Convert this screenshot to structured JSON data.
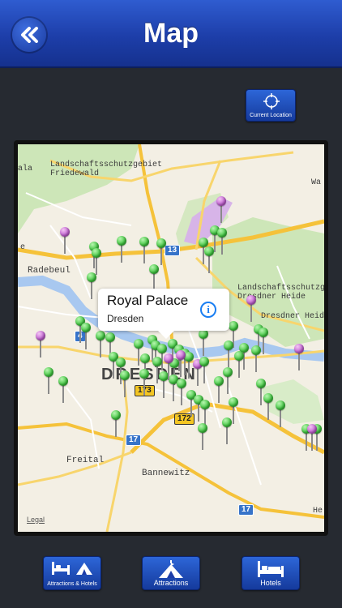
{
  "header": {
    "title": "Map",
    "back_icon": "double-chevron-left-icon"
  },
  "toolbar": {
    "current_location_label": "Current Location",
    "current_location_icon": "crosshair-icon"
  },
  "map": {
    "labels": {
      "nature_reserve_1_line1": "Landschaftsschutzgebiet",
      "nature_reserve_1_line2": "Friedewald",
      "nature_reserve_2_line1": "Landschaftsschutzgebi",
      "nature_reserve_2_line2": "Dresdner Heide",
      "heath_label": "Dresdner Heide",
      "radebeul": "Radebeul",
      "freital": "Freital",
      "bannewitz": "Bannewitz",
      "city": "DRESDEN",
      "edge_left_1": "ala",
      "edge_left_2": "e",
      "edge_right_1": "Wa",
      "edge_right_2": "He",
      "legal": "Legal"
    },
    "shields": {
      "a13": "13",
      "a4": "4",
      "b173": "173",
      "b172": "172",
      "a17_left": "17",
      "a17_right": "17"
    },
    "callout": {
      "title": "Royal Palace",
      "subtitle": "Dresden",
      "info_glyph": "i"
    },
    "colors": {
      "green_pin": "#3fc53f",
      "purple_pin": "#c060d0",
      "water": "#a8c8f0",
      "park": "#cde6b8",
      "motorway": "#f5c23a"
    }
  },
  "tabs": [
    {
      "label": "Attractions & Hotels",
      "icon": "attractions-hotels-icon"
    },
    {
      "label": "Attractions",
      "icon": "tent-icon"
    },
    {
      "label": "Hotels",
      "icon": "bed-icon"
    }
  ],
  "colors": {
    "header_blue": "#1d3ea9",
    "background": "#262a31"
  }
}
